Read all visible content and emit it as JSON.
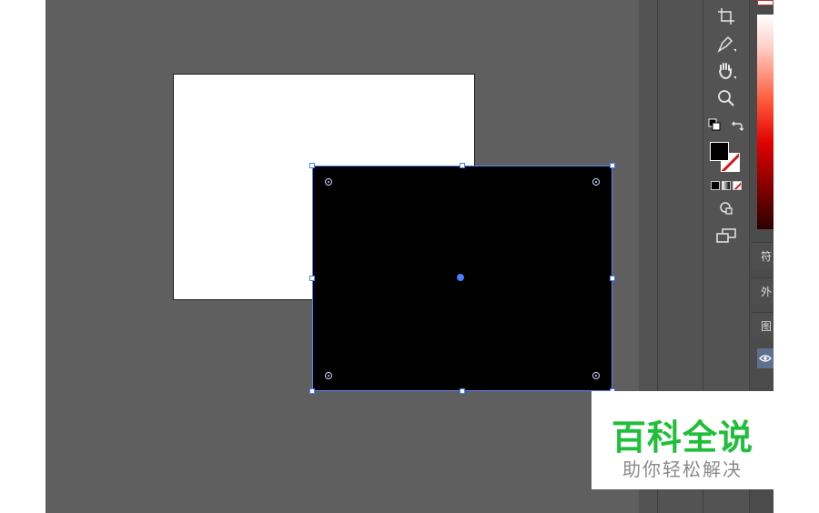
{
  "panels": {
    "symbols_tab": "符",
    "appearance_tab": "外",
    "layers_tab": "图",
    "visibility_icon": "eye-icon"
  },
  "tools": [
    "artboard-tool",
    "pen-tool",
    "hand-tool",
    "zoom-tool",
    "default-colors",
    "swap-colors",
    "fill-swatch",
    "stroke-swatch",
    "color-mode",
    "draw-mode",
    "screen-mode"
  ],
  "colors": {
    "canvas": "#5f5f5f",
    "selection": "#4f7cff",
    "shape_fill": "#000000",
    "artboard": "#ffffff"
  },
  "watermark": {
    "title": "百科全说",
    "subtitle": "助你轻松解决"
  }
}
